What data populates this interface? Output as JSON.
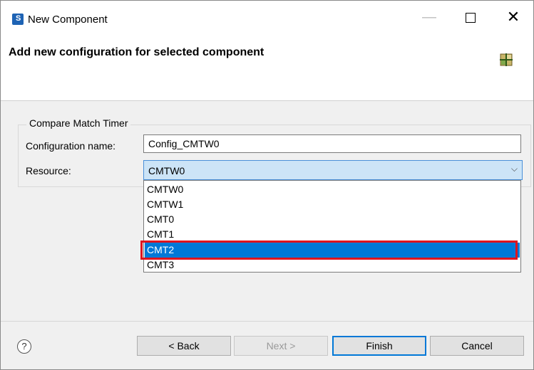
{
  "window": {
    "title": "New Component",
    "minimize_glyph": "—",
    "close_glyph": "✕"
  },
  "header": {
    "title": "Add new configuration for selected component",
    "icon": "component-grid-icon"
  },
  "group": {
    "label": "Compare Match Timer",
    "config_name_label": "Configuration name:",
    "config_name_value": "Config_CMTW0",
    "resource_label": "Resource:",
    "resource_value": "CMTW0",
    "resource_arrow": "⌵"
  },
  "dropdown": {
    "options": [
      "CMTW0",
      "CMTW1",
      "CMT0",
      "CMT1",
      "CMT2",
      "CMT3"
    ],
    "selected_index": 4
  },
  "buttons": {
    "help_glyph": "?",
    "back": "< Back",
    "next": "Next >",
    "finish": "Finish",
    "cancel": "Cancel"
  },
  "colors": {
    "accent": "#0078d7",
    "highlight_border": "#e0141e",
    "select_bg": "#cce4f7"
  }
}
